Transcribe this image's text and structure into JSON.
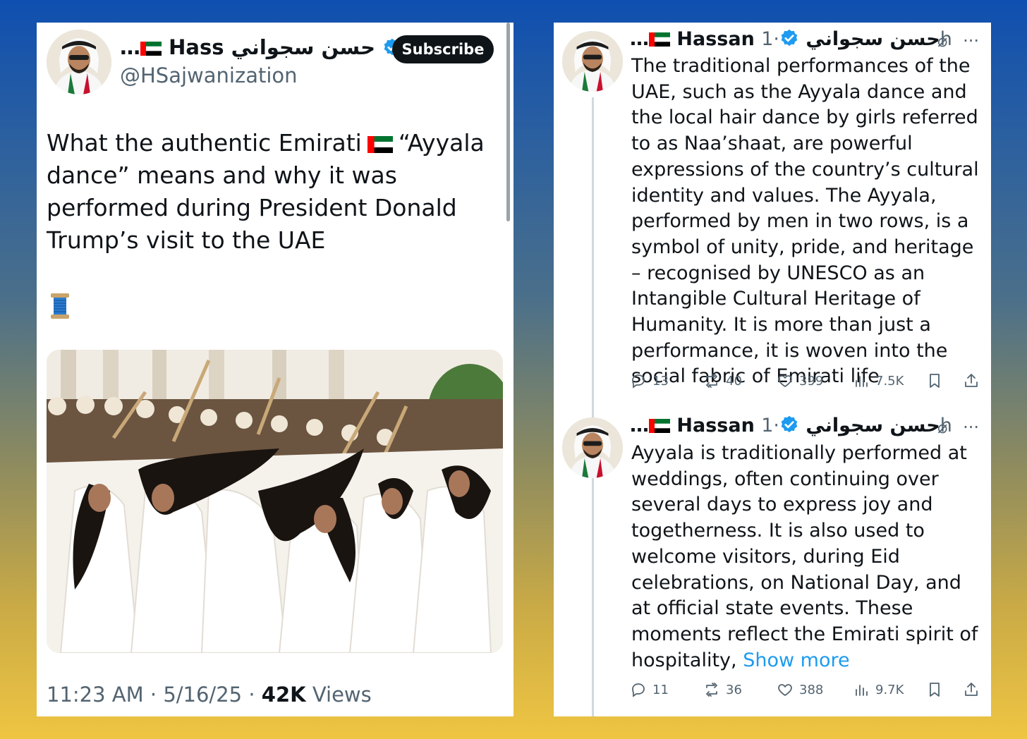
{
  "left_post": {
    "author_display": "…🇦🇪 Hass حسن سجواني",
    "author_prefix": "…",
    "author_name": "Hass",
    "author_arabic": "حسن سجواني",
    "handle": "@HSajwanization",
    "subscribe_label": "Subscribe",
    "text_part1": "What the authentic Emirati",
    "text_part2": "“Ayyala dance” means and why it was performed during President Donald Trump’s visit to the UAE",
    "emoji": "🧵",
    "time": "11:23 AM",
    "date": "5/16/25",
    "sep": "·",
    "views_count": "42K",
    "views_label": "Views"
  },
  "reply_1": {
    "author_prefix": "…",
    "author_name": "Hassan",
    "author_arabic": "حسن سجواني",
    "time": "·1h",
    "more": "···",
    "text": "The traditional performances of the UAE, such as the Ayyala dance and the local hair dance by girls referred to as Naa’shaat, are powerful expressions of the country’s cultural identity and values. The Ayyala, performed by men in two rows, is a symbol of unity, pride, and heritage – recognised by UNESCO as an Intangible Cultural Heritage of Humanity. It is more than just a performance, it is woven into the social fabric of Emirati life",
    "replies": "13",
    "reposts": "40",
    "likes": "399",
    "views": "7.5K"
  },
  "reply_2": {
    "author_prefix": "…",
    "author_name": "Hassan",
    "author_arabic": "حسن سجواني",
    "time": "·1h",
    "more": "···",
    "text": "Ayyala is traditionally performed at weddings, often continuing over several days to express joy and togetherness. It is also used to welcome visitors, during Eid celebrations, on National Day, and at official state events. These moments reflect the Emirati spirit of hospitality,",
    "show_more": "Show more",
    "replies": "11",
    "reposts": "36",
    "likes": "388",
    "views": "9.7K"
  },
  "colors": {
    "verified": "#1d9bf0",
    "link": "#1d9bf0",
    "muted": "#536471",
    "text": "#0f1419",
    "gradient_top": "#0f4fb0",
    "gradient_bottom": "#efc542"
  },
  "icons": [
    "verified-badge-icon",
    "uae-flag-icon",
    "spool-thread-icon",
    "reply-icon",
    "repost-icon",
    "like-icon",
    "views-icon",
    "bookmark-icon",
    "share-icon",
    "grok-slash-icon",
    "more-icon"
  ]
}
